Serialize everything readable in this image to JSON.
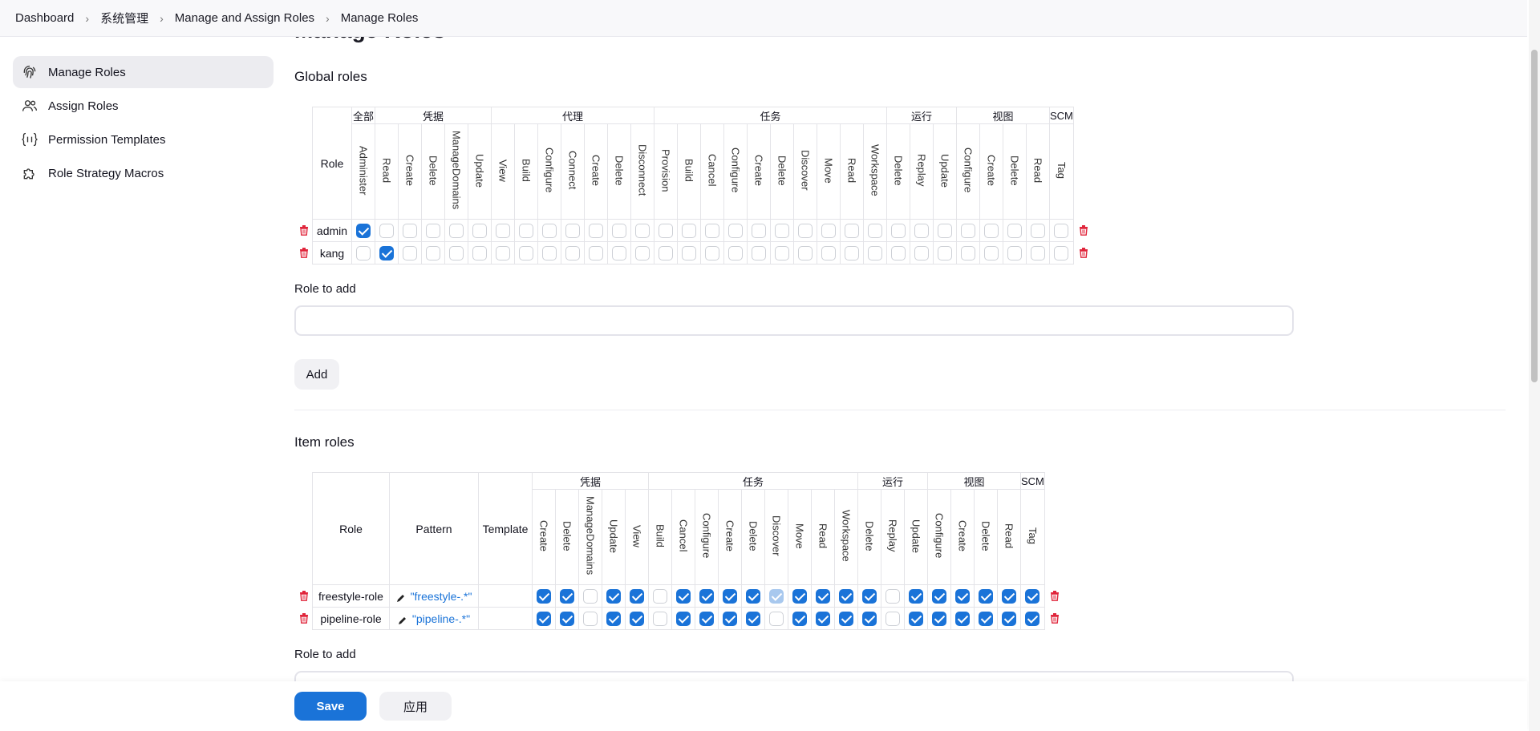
{
  "breadcrumb": [
    "Dashboard",
    "系统管理",
    "Manage and Assign Roles",
    "Manage Roles"
  ],
  "page_title": "Manage Roles",
  "sidebar": {
    "items": [
      {
        "label": "Manage Roles",
        "icon": "fingerprint-icon",
        "active": true
      },
      {
        "label": "Assign Roles",
        "icon": "people-icon",
        "active": false
      },
      {
        "label": "Permission Templates",
        "icon": "braces-icon",
        "active": false
      },
      {
        "label": "Role Strategy Macros",
        "icon": "puzzle-icon",
        "active": false
      }
    ]
  },
  "global_roles": {
    "title": "Global roles",
    "role_header": "Role",
    "groups": [
      {
        "name": "全部",
        "perms": [
          "Administer"
        ]
      },
      {
        "name": "凭据",
        "perms": [
          "Read",
          "Create",
          "Delete",
          "ManageDomains",
          "Update"
        ]
      },
      {
        "name": "代理",
        "perms": [
          "View",
          "Build",
          "Configure",
          "Connect",
          "Create",
          "Delete",
          "Disconnect"
        ]
      },
      {
        "name": "任务",
        "perms": [
          "Provision",
          "Build",
          "Cancel",
          "Configure",
          "Create",
          "Delete",
          "Discover",
          "Move",
          "Read",
          "Workspace"
        ]
      },
      {
        "name": "运行",
        "perms": [
          "Delete",
          "Replay",
          "Update"
        ]
      },
      {
        "name": "视图",
        "perms": [
          "Configure",
          "Create",
          "Delete",
          "Read"
        ]
      },
      {
        "name": "SCM",
        "perms": [
          "Tag"
        ]
      }
    ],
    "rows": [
      {
        "role": "admin",
        "checked": [
          0
        ]
      },
      {
        "role": "kang",
        "checked": [
          1
        ]
      }
    ],
    "role_to_add_label": "Role to add",
    "add_button": "Add"
  },
  "item_roles": {
    "title": "Item roles",
    "role_header": "Role",
    "pattern_header": "Pattern",
    "template_header": "Template",
    "groups": [
      {
        "name": "凭据",
        "perms": [
          "Create",
          "Delete",
          "ManageDomains",
          "Update",
          "View"
        ]
      },
      {
        "name": "任务",
        "perms": [
          "Build",
          "Cancel",
          "Configure",
          "Create",
          "Delete",
          "Discover",
          "Move",
          "Read",
          "Workspace"
        ]
      },
      {
        "name": "运行",
        "perms": [
          "Delete",
          "Replay",
          "Update"
        ]
      },
      {
        "name": "视图",
        "perms": [
          "Configure",
          "Create",
          "Delete",
          "Read"
        ]
      },
      {
        "name": "SCM",
        "perms": [
          "Tag"
        ]
      }
    ],
    "rows": [
      {
        "role": "freestyle-role",
        "pattern": "\"freestyle-.*\"",
        "checked": [
          0,
          1,
          3,
          4,
          6,
          7,
          8,
          9,
          11,
          12,
          13,
          14,
          16,
          17,
          18,
          19,
          20,
          21
        ],
        "dimmed": [
          10
        ]
      },
      {
        "role": "pipeline-role",
        "pattern": "\"pipeline-.*\"",
        "checked": [
          0,
          1,
          3,
          4,
          6,
          7,
          8,
          9,
          11,
          12,
          13,
          14,
          16,
          17,
          18,
          19,
          20,
          21
        ],
        "dimmed": []
      }
    ],
    "role_to_add_label": "Role to add"
  },
  "footer": {
    "save": "Save",
    "apply": "应用"
  },
  "colors": {
    "accent": "#1a73d8",
    "danger": "#e0253b"
  }
}
